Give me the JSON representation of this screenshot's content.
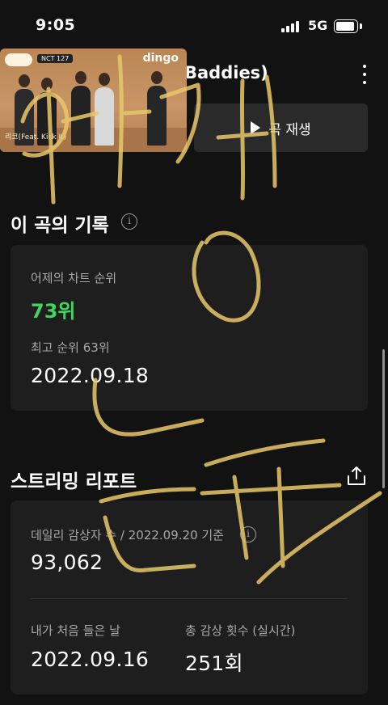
{
  "status_bar": {
    "time": "9:05",
    "network": "5G"
  },
  "header": {
    "song_title_partial": "Baddies)",
    "video_caption": "리코(Feat. Kick It)",
    "video_brand": "dingo",
    "video_badge": "NCT 127"
  },
  "play_button": {
    "label": "곡 재생"
  },
  "record": {
    "title": "이 곡의 기록",
    "yesterday_rank_label": "어제의 차트 순위",
    "yesterday_rank_value": "73위",
    "best_rank_label": "최고 순위 63위",
    "best_rank_date": "2022.09.18"
  },
  "streaming": {
    "title": "스트리밍 리포트",
    "daily_listeners_label": "데일리 감상자 수 / 2022.09.20 기준",
    "daily_listeners_value": "93,062",
    "first_listen_label": "내가 처음 들은 날",
    "first_listen_value": "2022.09.16",
    "total_plays_label": "총 감상 횟수 (실시간)",
    "total_plays_value": "251회"
  },
  "colors": {
    "background": "#121212",
    "card": "#1e1e1e",
    "rank_green": "#41d461",
    "handwriting": "#e8c86a"
  },
  "icons": [
    "more-icon",
    "play-icon",
    "info-icon",
    "share-icon"
  ]
}
